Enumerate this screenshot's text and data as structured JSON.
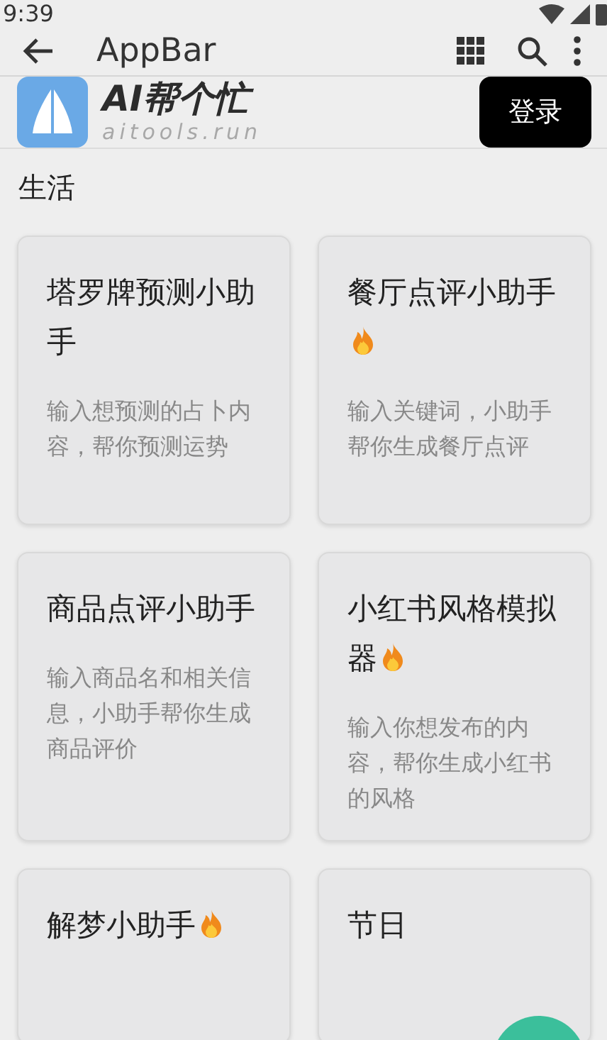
{
  "status_bar": {
    "time": "9:39"
  },
  "app_bar": {
    "title": "AppBar"
  },
  "header": {
    "brand_name": "AI帮个忙",
    "brand_domain": "aitools.run",
    "login_button": "登录"
  },
  "section": {
    "title": "生活"
  },
  "cards": [
    {
      "title": "塔罗牌预测小助手",
      "hot": false,
      "description": "输入想预测的占卜内容，帮你预测运势"
    },
    {
      "title": "餐厅点评小助手",
      "hot": true,
      "description": "输入关键词，小助手帮你生成餐厅点评"
    },
    {
      "title": "商品点评小助手",
      "hot": false,
      "description": "输入商品名和相关信息，小助手帮你生成商品评价"
    },
    {
      "title": "小红书风格模拟器",
      "hot": true,
      "description": "输入你想发布的内容，帮你生成小红书的风格"
    },
    {
      "title": "解梦小助手",
      "hot": true
    },
    {
      "title": "节日",
      "hot": false
    }
  ]
}
